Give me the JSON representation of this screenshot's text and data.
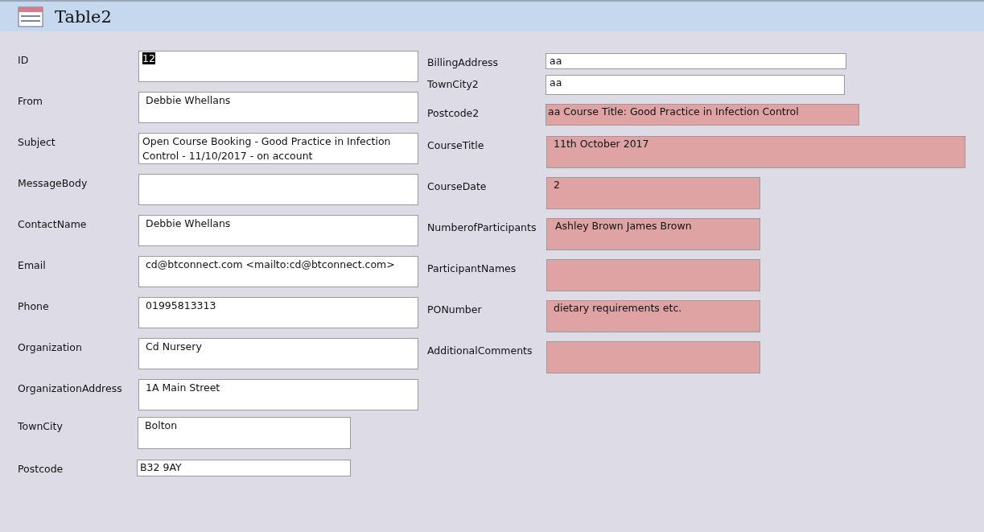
{
  "window": {
    "title": "Table2"
  },
  "left_fields": [
    {
      "label": "ID",
      "value": "12",
      "highlighted": false,
      "text_selected": true
    },
    {
      "label": "From",
      "value": "Debbie Whellans",
      "highlighted": false,
      "text_selected": false
    },
    {
      "label": "Subject",
      "value": "Open Course Booking - Good Practice in Infection Control - 11/10/2017 - on account",
      "highlighted": false,
      "text_selected": false
    },
    {
      "label": "MessageBody",
      "highlighted": false
    },
    {
      "label": "ContactName",
      "value": "Debbie Whellans",
      "highlighted": false,
      "text_selected": false
    },
    {
      "label": "Email",
      "value": "cd@btconnect.com <mailto:cd@btconnect.com>",
      "highlighted": false,
      "text_selected": false
    },
    {
      "label": "Phone",
      "value": "01995813313",
      "highlighted": false,
      "text_selected": false
    },
    {
      "label": "Organization",
      "value": "Cd Nursery",
      "highlighted": false,
      "text_selected": false
    },
    {
      "label": "OrganizationAddress",
      "value": "1A Main Street",
      "highlighted": false,
      "text_selected": false
    },
    {
      "label": "TownCity",
      "value": "Bolton",
      "highlighted": false,
      "text_selected": false
    },
    {
      "label": "Postcode",
      "value": "B32 9AY",
      "highlighted": false,
      "text_selected": false
    }
  ],
  "right_fields": [
    {
      "label": "BillingAddress",
      "value": "aa",
      "highlighted": false,
      "text_selected": false
    },
    {
      "label": "TownCity2",
      "value": "aa",
      "highlighted": false,
      "text_selected": false
    },
    {
      "label": "Postcode2",
      "value": "aa  Course Title: Good Practice in Infection Control",
      "highlighted": true,
      "text_selected": false
    },
    {
      "label": "CourseTitle",
      "value": "11th October 2017",
      "highlighted": true,
      "text_selected": false
    },
    {
      "label": "CourseDate",
      "value": "2",
      "highlighted": true,
      "text_selected": false
    },
    {
      "label": "NumberofParticipants",
      "value": "Ashley Brown James Brown",
      "highlighted": true,
      "text_selected": false
    },
    {
      "label": "ParticipantNames",
      "highlighted": true
    },
    {
      "label": "PONumber",
      "value": "dietary requirements etc.",
      "highlighted": true,
      "text_selected": false
    },
    {
      "label": "AdditionalComments",
      "highlighted": true
    }
  ]
}
